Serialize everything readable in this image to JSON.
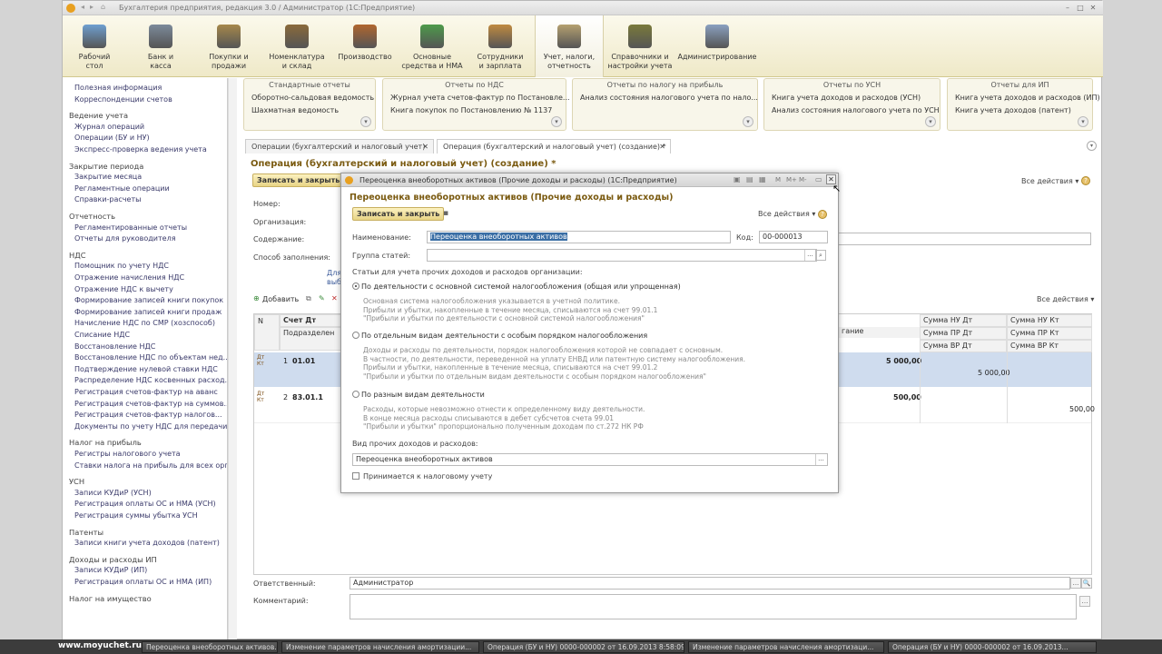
{
  "window_title": "Бухгалтерия предприятия, редакция 3.0 / Администратор  (1С:Предприятие)",
  "sections": [
    {
      "label": "Рабочий\nстол",
      "icon": "desk-icon",
      "color": "#6f9fd0"
    },
    {
      "label": "Банк и\nкасса",
      "icon": "bank-icon",
      "color": "#7c8a9a"
    },
    {
      "label": "Покупки и\nпродажи",
      "icon": "truck-icon",
      "color": "#a6884a"
    },
    {
      "label": "Номенклатура\nи склад",
      "icon": "warehouse-icon",
      "color": "#8a6a3a"
    },
    {
      "label": "Производство",
      "icon": "factory-icon",
      "color": "#b0662e"
    },
    {
      "label": "Основные\nсредства и НМА",
      "icon": "assets-icon",
      "color": "#4d9a4a"
    },
    {
      "label": "Сотрудники\nи зарплата",
      "icon": "employees-icon",
      "color": "#c08a40"
    },
    {
      "label": "Учет, налоги,\nотчетность",
      "icon": "accounting-icon",
      "color": "#b5a070"
    },
    {
      "label": "Справочники и\nнастройки учета",
      "icon": "books-icon",
      "color": "#7a7a3a"
    },
    {
      "label": "Администрирование",
      "icon": "admin-icon",
      "color": "#8aa0c0"
    }
  ],
  "sidebar": {
    "items": [
      {
        "label": "Полезная информация",
        "h": false
      },
      {
        "label": "Корреспонденции счетов",
        "h": false
      },
      {
        "label": "Ведение учета",
        "h": true
      },
      {
        "label": "Журнал операций",
        "h": false
      },
      {
        "label": "Операции (БУ и НУ)",
        "h": false
      },
      {
        "label": "Экспресс-проверка ведения учета",
        "h": false
      },
      {
        "label": "Закрытие периода",
        "h": true
      },
      {
        "label": "Закрытие месяца",
        "h": false
      },
      {
        "label": "Регламентные операции",
        "h": false
      },
      {
        "label": "Справки-расчеты",
        "h": false
      },
      {
        "label": "Отчетность",
        "h": true
      },
      {
        "label": "Регламентированные отчеты",
        "h": false
      },
      {
        "label": "Отчеты для руководителя",
        "h": false
      },
      {
        "label": "НДС",
        "h": true
      },
      {
        "label": "Помощник по учету НДС",
        "h": false
      },
      {
        "label": "Отражение начисления НДС",
        "h": false
      },
      {
        "label": "Отражение НДС к вычету",
        "h": false
      },
      {
        "label": "Формирование записей книги покупок",
        "h": false
      },
      {
        "label": "Формирование записей книги продаж",
        "h": false
      },
      {
        "label": "Начисление НДС по СМР (хозспособ)",
        "h": false
      },
      {
        "label": "Списание НДС",
        "h": false
      },
      {
        "label": "Восстановление НДС",
        "h": false
      },
      {
        "label": "Восстановление НДС по объектам нед...",
        "h": false
      },
      {
        "label": "Подтверждение нулевой ставки НДС",
        "h": false
      },
      {
        "label": "Распределение НДС косвенных расход...",
        "h": false
      },
      {
        "label": "Регистрация счетов-фактур на аванс",
        "h": false
      },
      {
        "label": "Регистрация счетов-фактур на суммов...",
        "h": false
      },
      {
        "label": "Регистрация счетов-фактур налогов...",
        "h": false
      },
      {
        "label": "Документы по учету НДС для передачи...",
        "h": false
      },
      {
        "label": "Налог на прибыль",
        "h": true
      },
      {
        "label": "Регистры налогового учета",
        "h": false
      },
      {
        "label": "Ставки налога на прибыль для всех орг...",
        "h": false
      },
      {
        "label": "УСН",
        "h": true
      },
      {
        "label": "Записи КУДиР (УСН)",
        "h": false
      },
      {
        "label": "Регистрация оплаты ОС и НМА (УСН)",
        "h": false
      },
      {
        "label": "Регистрация суммы убытка УСН",
        "h": false
      },
      {
        "label": "Патенты",
        "h": true
      },
      {
        "label": "Записи книги учета доходов (патент)",
        "h": false
      },
      {
        "label": "Доходы и расходы ИП",
        "h": true
      },
      {
        "label": "Записи КУДиР (ИП)",
        "h": false
      },
      {
        "label": "Регистрация оплаты ОС и НМА (ИП)",
        "h": false
      },
      {
        "label": "Налог на имущество",
        "h": true
      }
    ]
  },
  "report_groups": [
    {
      "title": "Стандартные отчеты",
      "items": [
        "Оборотно-сальдовая ведомость",
        "Шахматная ведомость"
      ]
    },
    {
      "title": "Отчеты по НДС",
      "items": [
        "Журнал учета счетов-фактур по Постановле...",
        "Книга покупок по Постановлению № 1137"
      ]
    },
    {
      "title": "Отчеты по налогу на прибыль",
      "items": [
        "Анализ состояния налогового учета по нало..."
      ]
    },
    {
      "title": "Отчеты по УСН",
      "items": [
        "Книга учета доходов и расходов (УСН)",
        "Анализ состояния налогового учета по УСН"
      ]
    },
    {
      "title": "Отчеты для ИП",
      "items": [
        "Книга учета доходов и расходов (ИП)",
        "Книга учета доходов (патент)"
      ]
    }
  ],
  "tabs": [
    "Операции (бухгалтерский и налоговый учет)",
    "Операция (бухгалтерский и налоговый учет) (создание) *"
  ],
  "form": {
    "title": "Операция (бухгалтерский и налоговый учет) (создание) *",
    "save_close": "Записать и закрыть",
    "all_actions": "Все действия ▾",
    "labels": {
      "number": "Номер:",
      "org": "Организация:",
      "content": "Содержание:",
      "fill_method": "Способ заполнения:"
    },
    "link_partial": "Для\nвыб",
    "add_button": "Добавить",
    "grid_headers": {
      "n": "N",
      "debit": "Счет Дт",
      "subconto": "Подразделен",
      "nu_dt": "Сумма НУ Дт",
      "nu_kt": "Сумма НУ Кт",
      "pr_dt": "Сумма ПР Дт",
      "pr_kt": "Сумма ПР Кт",
      "vr_dt": "Сумма ВР Дт",
      "vr_kt": "Сумма ВР Кт",
      "sum_partial": "гание"
    },
    "rows": [
      {
        "n": "1",
        "account": "01.01",
        "amount": "5 000,00",
        "nu": "5 000,00"
      },
      {
        "n": "2",
        "account": "83.01.1",
        "amount": "500,00",
        "nu": "500,00"
      }
    ],
    "responsible_label": "Ответственный:",
    "responsible_value": "Администратор",
    "comment_label": "Комментарий:"
  },
  "dialog": {
    "window_title": "Переоценка внеоборотных активов (Прочие доходы и расходы)  (1С:Предприятие)",
    "title_controls": [
      "M",
      "M+",
      "M-"
    ],
    "heading": "Переоценка внеоборотных активов (Прочие доходы и расходы)",
    "save_close": "Записать и закрыть",
    "all_actions": "Все действия ▾",
    "name_label": "Наименование:",
    "name_value": "Переоценка внеоборотных активов",
    "code_label": "Код:",
    "code_value": "00-000013",
    "group_label": "Группа статей:",
    "section_label": "Статьи для учета прочих доходов и расходов организации:",
    "options": [
      {
        "label": "По деятельности с основной системой налогообложения (общая или упрощенная)",
        "selected": true,
        "note": "Основная система налогообложения указывается в учетной политике.\nПрибыли и убытки, накопленные в течение месяца, списываются на счет 99.01.1\n\"Прибыли и убытки по деятельности с основной системой налогообложения\""
      },
      {
        "label": "По отдельным видам деятельности с особым порядком налогообложения",
        "selected": false,
        "note": "Доходы и расходы по деятельности, порядок налогообложения которой не совпадает с основным.\nВ частности, по деятельности, переведенной на уплату ЕНВД или патентную систему налогообложения.\nПрибыли и убытки, накопленные в течение месяца, списываются на счет 99.01.2\n\"Прибыли и убытки по отдельным видам деятельности с особым порядком налогообложения\""
      },
      {
        "label": "По разным видам деятельности",
        "selected": false,
        "note": "Расходы, которые невозможно отнести к определенному виду деятельности.\nВ конце месяца расходы списываются в дебет субсчетов счета 99.01\n\"Прибыли и убытки\" пропорционально полученным доходам по ст.272 НК РФ"
      }
    ],
    "kind_label": "Вид прочих доходов и расходов:",
    "kind_value": "Переоценка внеоборотных активов",
    "tax_checkbox": "Принимается к налоговому учету"
  },
  "taskbar": {
    "site": "www.moyuchet.ru",
    "items": [
      "Переоценка внеоборотных активов...",
      "Изменение параметров начисления амортизации...",
      "Операция (БУ и НУ) 0000-000002 от 16.09.2013 8:58:09",
      "Изменение параметров начисления амортизаци...",
      "Операция (БУ и НУ) 0000-000002 от 16.09.2013..."
    ]
  }
}
